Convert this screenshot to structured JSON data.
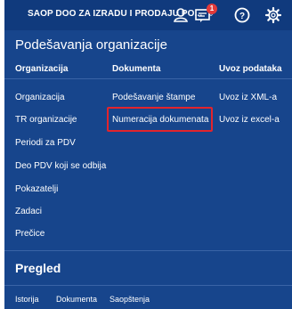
{
  "topbar": {
    "org_name": "SAOP DOO ZA IZRADU I PRODAJU PO...",
    "org_chevron": "⌄",
    "icons": [
      "user-icon",
      "messages-icon",
      "help-icon",
      "settings-icon"
    ],
    "notification_count": "1"
  },
  "menu": {
    "title": "Podešavanja organizacije",
    "columns": [
      {
        "header": "Organizacija",
        "items": [
          "Organizacija",
          "TR organizacije",
          "Periodi za PDV",
          "Deo PDV koji se odbija",
          "Pokazatelji",
          "Zadaci",
          "Prečice"
        ]
      },
      {
        "header": "Dokumenta",
        "items": [
          "Podešavanje štampe",
          "Numeracija dokumenata"
        ]
      },
      {
        "header": "Uvoz podataka",
        "items": [
          "Uvoz iz XML-a",
          "Uvoz iz excel-a"
        ]
      }
    ],
    "highlighted_item": "Numeracija dokumenata",
    "highlight_color": "#e2242c"
  },
  "review": {
    "title": "Pregled",
    "links": [
      "Istorija",
      "Dokumenta",
      "Saopštenja"
    ]
  },
  "colors": {
    "panel_bg": "#17458c",
    "topbar_bg": "#103a7d",
    "badge": "#e23a3a"
  }
}
